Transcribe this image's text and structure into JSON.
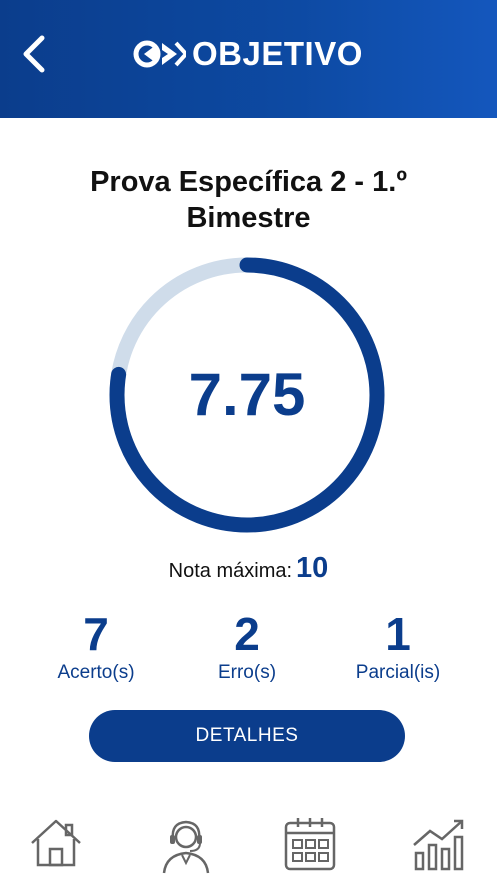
{
  "header": {
    "logo_text": "OBJETIVO",
    "back_icon": "chevron-left-icon"
  },
  "exam": {
    "title_line1": "Prova Específica 2 - 1.º",
    "title_line2": "Bimestre"
  },
  "score": {
    "grade": "7.75",
    "max_label": "Nota máxima:",
    "max_value": "10",
    "progress": 0.775
  },
  "stats": [
    {
      "value": "7",
      "label": "Acerto(s)"
    },
    {
      "value": "2",
      "label": "Erro(s)"
    },
    {
      "value": "1",
      "label": "Parcial(is)"
    }
  ],
  "details_button": "DETALHES",
  "nav": [
    "home-icon",
    "support-agent-icon",
    "calendar-icon",
    "chart-icon"
  ],
  "colors": {
    "primary": "#0b3d8c",
    "track": "#cfdcea"
  }
}
